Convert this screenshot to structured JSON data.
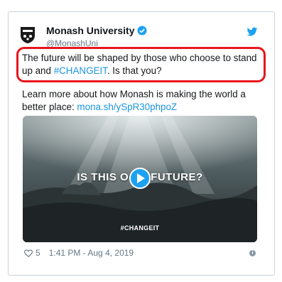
{
  "tweet": {
    "author_name": "Monash University",
    "author_handle": "@MonashUni",
    "text_before_hashtag": "The future will be shaped by those who choose to stand up and ",
    "hashtag": "#CHANGEIT",
    "text_after_hashtag": ". Is that you?",
    "body2_text": "Learn more about how Monash is making the world a better place: ",
    "body2_link": "mona.sh/ySpR30phpoZ",
    "likes": "5",
    "timestamp": "1:41 PM - Aug 4, 2019"
  },
  "media": {
    "title_left": "IS THIS O",
    "title_right": "FUTURE?",
    "hashtag": "#CHANGEIT"
  },
  "colors": {
    "link": "#1b95e0",
    "highlight": "#e8161c",
    "play": "#1da1f2"
  },
  "icons": [
    "monash-crest-icon",
    "verified-badge-icon",
    "twitter-bird-icon",
    "play-icon",
    "heart-icon",
    "info-icon"
  ]
}
